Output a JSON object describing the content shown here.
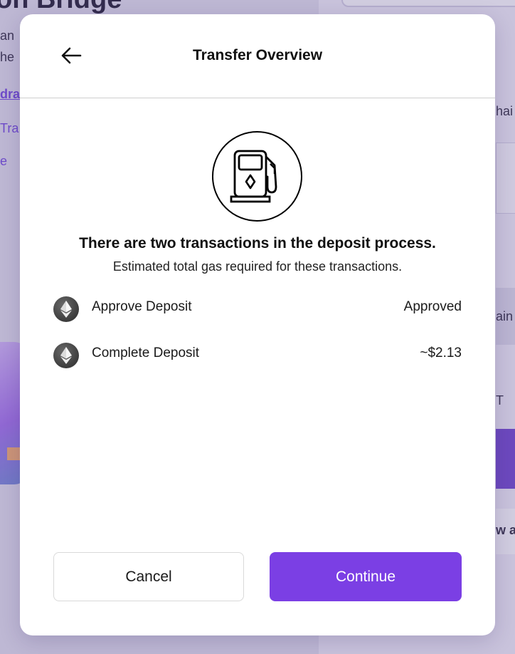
{
  "background": {
    "title": "on Bridge",
    "left_lines": [
      "an",
      "he"
    ],
    "links": [
      "dra",
      "Tra",
      "e"
    ],
    "right_lines": [
      "hai",
      "ain",
      "T",
      "w a"
    ]
  },
  "modal": {
    "title": "Transfer Overview",
    "back_icon": "arrow-left-icon",
    "illustration_icon": "gas-pump-icon",
    "headline": "There are two transactions in the deposit process.",
    "subline": "Estimated total gas required for these transactions.",
    "transactions": [
      {
        "icon": "ethereum-icon",
        "label": "Approve Deposit",
        "value": "Approved"
      },
      {
        "icon": "ethereum-icon",
        "label": "Complete Deposit",
        "value": "~$2.13"
      }
    ],
    "cancel_label": "Cancel",
    "continue_label": "Continue"
  },
  "colors": {
    "accent": "#7b3fe4",
    "modal_bg": "#ffffff",
    "backdrop": "#d6d0e6"
  }
}
